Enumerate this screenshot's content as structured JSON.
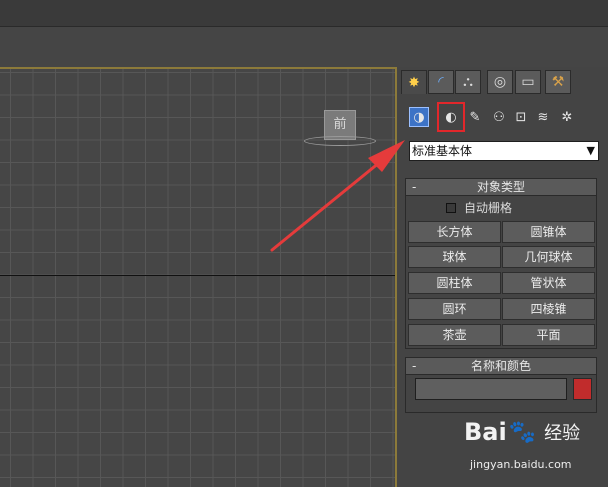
{
  "viewport": {
    "cube_label": "前"
  },
  "command_panel": {
    "tabs": [
      {
        "icon": "create-tab-icon",
        "glyph": "✸"
      },
      {
        "icon": "modify-tab-icon",
        "glyph": "◜"
      },
      {
        "icon": "hierarchy-tab-icon",
        "glyph": "⛬"
      },
      {
        "icon": "motion-tab-icon",
        "glyph": "◎"
      },
      {
        "icon": "display-tab-icon",
        "glyph": "▭"
      },
      {
        "icon": "utilities-tab-icon",
        "glyph": "⚒"
      }
    ],
    "create_categories": [
      {
        "icon": "geometry-icon",
        "glyph": "◑",
        "selected": true
      },
      {
        "icon": "shapes-icon",
        "glyph": "◐",
        "selected": false
      },
      {
        "icon": "lights-icon",
        "glyph": "✎",
        "selected": false
      },
      {
        "icon": "cameras-icon",
        "glyph": "⚇",
        "selected": false
      },
      {
        "icon": "helpers-icon",
        "glyph": "⊡",
        "selected": false
      },
      {
        "icon": "space-warps-icon",
        "glyph": "≋",
        "selected": false
      },
      {
        "icon": "systems-icon",
        "glyph": "✲",
        "selected": false
      }
    ],
    "dropdown_value": "标准基本体",
    "object_type": {
      "title": "对象类型",
      "collapse": "-",
      "autogrid_label": "自动栅格",
      "buttons": [
        "长方体",
        "圆锥体",
        "球体",
        "几何球体",
        "圆柱体",
        "管状体",
        "圆环",
        "四棱锥",
        "茶壶",
        "平面"
      ]
    },
    "name_color": {
      "title": "名称和颜色",
      "collapse": "-",
      "name_value": "",
      "swatch_color": "#c12c2c"
    }
  },
  "watermark": {
    "brand": "Bai",
    "brand_suffix": "经验",
    "url": "jingyan.baidu.com"
  },
  "colors": {
    "highlight": "#e2272b",
    "arrow": "#e53b3b",
    "selected": "#3d73c6"
  }
}
